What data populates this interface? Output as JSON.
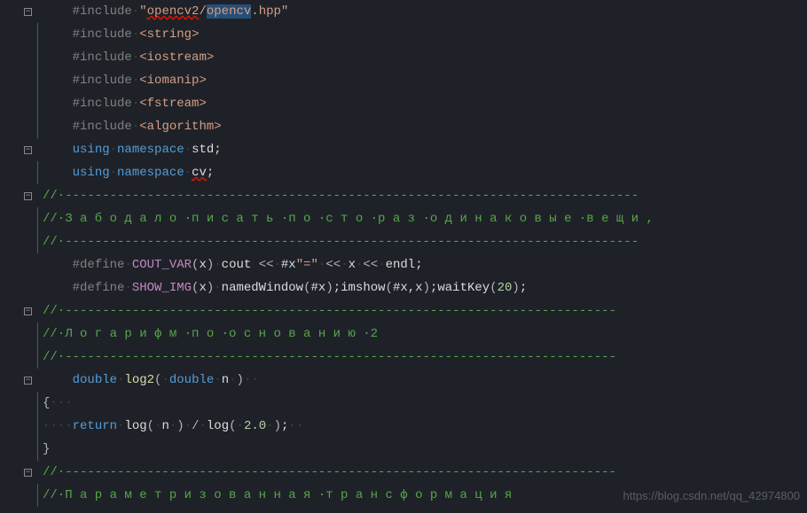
{
  "watermark": "https://blog.csdn.net/qq_42974800",
  "tokens": {
    "include": "#include",
    "define": "#define",
    "using": "using",
    "namespace": "namespace",
    "return": "return",
    "double": "double",
    "std": "std",
    "cv": "cv",
    "string": "string",
    "iostream": "iostream",
    "iomanip": "iomanip",
    "fstream": "fstream",
    "algorithm": "algorithm",
    "hpp": "hpp",
    "opencv2": "opencv2",
    "opencv": "opencv",
    "COUT_VAR": "COUT_VAR",
    "SHOW_IMG": "SHOW_IMG",
    "cout": "cout",
    "endl": "endl",
    "namedWindow": "namedWindow",
    "imshow": "imshow",
    "waitKey": "waitKey",
    "log2": "log2",
    "log": "log",
    "n": "n",
    "x": "x",
    "twenty": "20",
    "two_point_zero": "2.0",
    "comment_dashes": "//·--------------------------------------------------------------------------",
    "comment_dashes_long": "//·-----------------------------------------------------------------------------",
    "comment_ru1": "//·З а б о д а л о ·п и с а т ь ·п о ·с т о ·р а з ·о д и н а к о в ы е ·в е щ и ,",
    "comment_ru2": "//·Л о г а р и ф м ·п о ·о с н о в а н и ю ·2",
    "comment_ru3": "//·П а р а м е т р и з о в а н н а я ·т р а н с ф о р м а ц и я",
    "cout_var_expr_1": "·cout·<<·#x",
    "cout_var_eq": "\"=\"",
    "cout_var_expr_2": "·<<·x·<<·endl;",
    "show_img_expr": "·namedWindow(#x);imshow(#x,x);waitKey(",
    "show_img_close": ");",
    "semi": ";",
    "lt": "<",
    "gt": ">",
    "quote": "\"",
    "slash": "/",
    "dot_char": ".",
    "lparen": "(",
    "rparen": ")",
    "lbrace": "{",
    "rbrace": "}",
    "middle_dot": "·"
  }
}
